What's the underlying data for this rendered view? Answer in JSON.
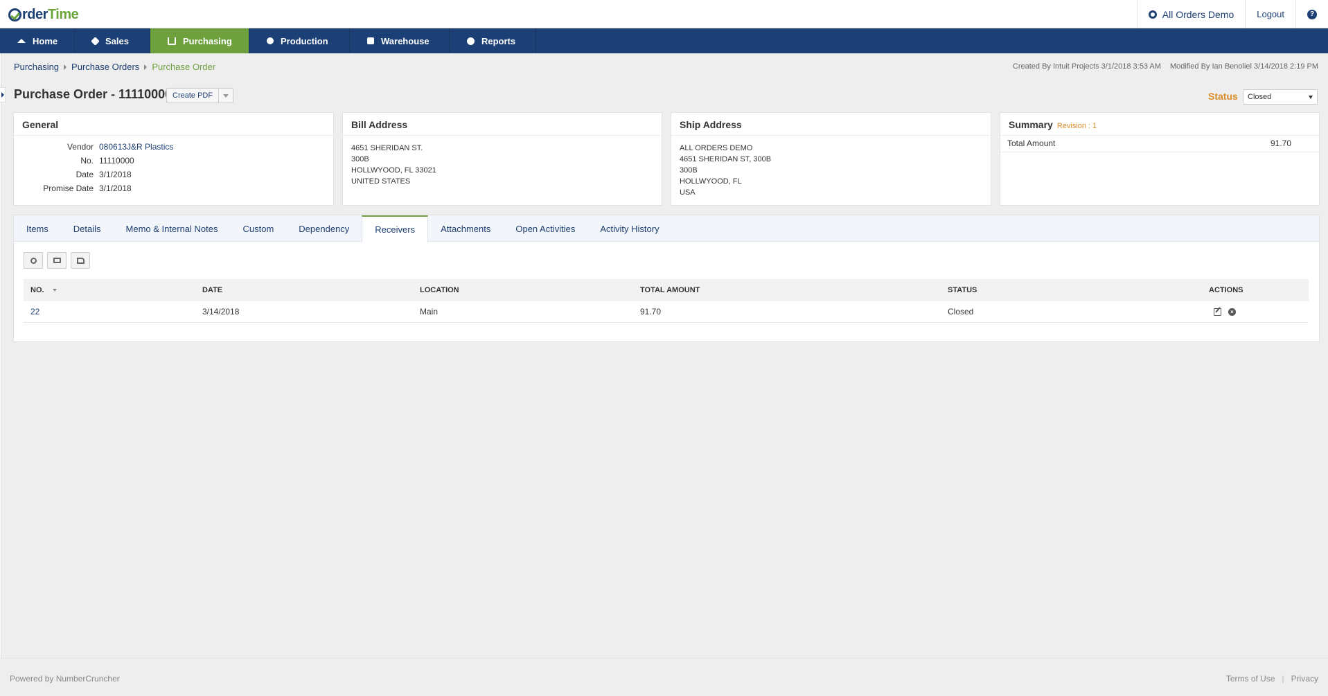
{
  "header": {
    "logo_order": "rder",
    "logo_time": "Time",
    "company": "All Orders Demo",
    "logout": "Logout",
    "help": "?"
  },
  "nav": [
    {
      "label": "Home",
      "icon": "home-icon"
    },
    {
      "label": "Sales",
      "icon": "tag-icon"
    },
    {
      "label": "Purchasing",
      "icon": "cart-icon",
      "active": true
    },
    {
      "label": "Production",
      "icon": "gears-icon"
    },
    {
      "label": "Warehouse",
      "icon": "box-icon"
    },
    {
      "label": "Reports",
      "icon": "pie-chart-icon"
    }
  ],
  "breadcrumb": {
    "items": [
      "Purchasing",
      "Purchase Orders"
    ],
    "current": "Purchase Order"
  },
  "meta": {
    "created": "Created By Intuit Projects 3/1/2018 3:53 AM",
    "modified": "Modified By Ian Benoliel 3/14/2018 2:19 PM"
  },
  "title": {
    "text": "Purchase Order - 11110000",
    "pdf_button": "Create PDF",
    "status_label": "Status",
    "status_value": "Closed"
  },
  "general": {
    "heading": "General",
    "vendor_label": "Vendor",
    "vendor_value": "080613J&R Plastics",
    "no_label": "No.",
    "no_value": "11110000",
    "date_label": "Date",
    "date_value": "3/1/2018",
    "promise_label": "Promise Date",
    "promise_value": "3/1/2018"
  },
  "bill_address": {
    "heading": "Bill Address",
    "lines": [
      "4651 SHERIDAN ST.",
      "300B",
      "HOLLWYOOD, FL 33021",
      "UNITED STATES"
    ]
  },
  "ship_address": {
    "heading": "Ship Address",
    "lines": [
      "ALL ORDERS DEMO",
      "4651 SHERIDAN ST, 300B",
      "300B",
      "HOLLWYOOD, FL",
      "USA"
    ]
  },
  "summary": {
    "heading": "Summary",
    "revision": "Revision : 1",
    "total_label": "Total Amount",
    "total_value": "91.70"
  },
  "tabs": [
    {
      "label": "Items"
    },
    {
      "label": "Details"
    },
    {
      "label": "Memo & Internal Notes"
    },
    {
      "label": "Custom"
    },
    {
      "label": "Dependency"
    },
    {
      "label": "Receivers",
      "active": true
    },
    {
      "label": "Attachments"
    },
    {
      "label": "Open Activities"
    },
    {
      "label": "Activity History"
    }
  ],
  "grid": {
    "columns": [
      "NO.",
      "DATE",
      "LOCATION",
      "TOTAL AMOUNT",
      "STATUS",
      "ACTIONS"
    ],
    "rows": [
      {
        "no": "22",
        "date": "3/14/2018",
        "location": "Main",
        "total": "91.70",
        "status": "Closed"
      }
    ]
  },
  "footer": {
    "powered": "Powered by NumberCruncher",
    "terms": "Terms of Use",
    "sep": "|",
    "privacy": "Privacy"
  },
  "colors": {
    "nav_bg": "#1c4075",
    "accent_green": "#6ea13d",
    "status_orange": "#d98c2a",
    "link_blue": "#1d3f73"
  }
}
